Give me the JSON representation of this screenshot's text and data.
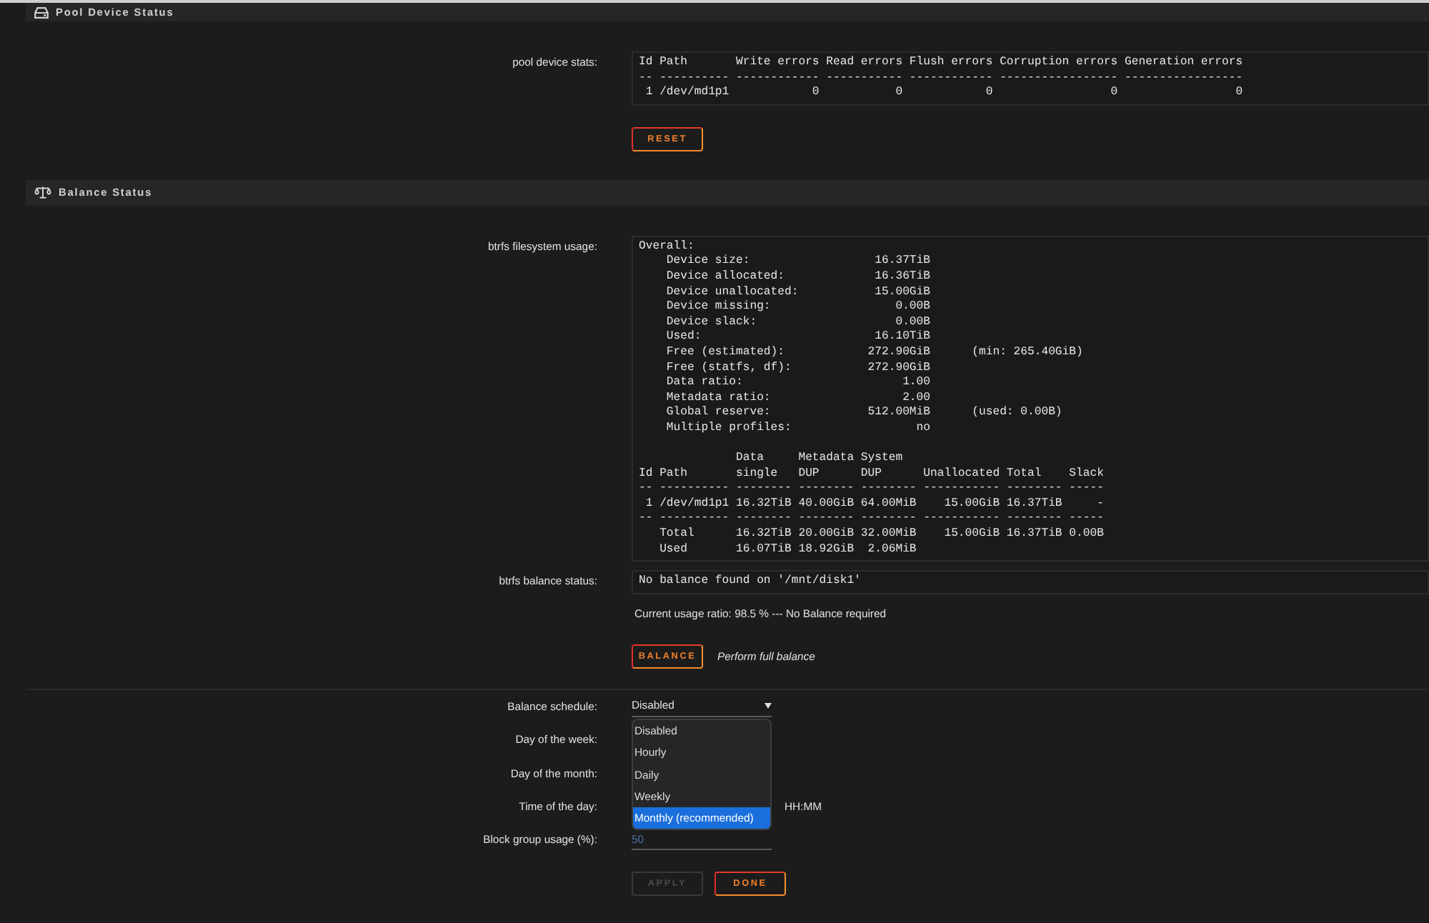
{
  "pool_device_status": {
    "title": "Pool Device Status",
    "stats": {
      "label": "pool device stats:",
      "lines": [
        "Id Path       Write errors Read errors Flush errors Corruption errors Generation errors",
        "-- ---------- ------------ ----------- ------------ ----------------- -----------------",
        " 1 /dev/md1p1            0           0            0                 0                 0"
      ]
    },
    "button": {
      "label": "RESET",
      "disabled": false
    }
  },
  "balance_status": {
    "title": "Balance Status",
    "filesystem_usage": {
      "label": "btrfs filesystem usage:",
      "summary_lines": [
        "Overall:",
        "    Device size:                  16.37TiB",
        "    Device allocated:             16.36TiB",
        "    Device unallocated:           15.00GiB",
        "    Device missing:                  0.00B",
        "    Device slack:                    0.00B",
        "    Used:                         16.10TiB",
        "    Free (estimated):            272.90GiB      (min: 265.40GiB)",
        "    Free (statfs, df):           272.90GiB",
        "    Data ratio:                       1.00",
        "    Metadata ratio:                   2.00",
        "    Global reserve:              512.00MiB      (used: 0.00B)",
        "    Multiple profiles:                  no"
      ],
      "table_lines": [
        "              Data     Metadata System",
        "Id Path       single   DUP      DUP      Unallocated Total    Slack",
        "-- ---------- -------- -------- -------- ----------- -------- -----",
        " 1 /dev/md1p1 16.32TiB 40.00GiB 64.00MiB    15.00GiB 16.37TiB     -",
        "-- ---------- -------- -------- -------- ----------- -------- -----",
        "   Total      16.32TiB 20.00GiB 32.00MiB    15.00GiB 16.37TiB 0.00B",
        "   Used       16.07TiB 18.92GiB  2.06MiB"
      ]
    },
    "balance_output": {
      "label": "btrfs balance status:",
      "lines": [
        "No balance found on '/mnt/disk1'"
      ]
    },
    "usage_ratio": "Current usage ratio: 98.5 % --- No Balance required",
    "button": {
      "label": "BALANCE",
      "disabled": false
    },
    "button_note": "Perform full balance",
    "schedule_form": {
      "fields": [
        {
          "kind": "select",
          "label": "Balance schedule:",
          "value": "Disabled",
          "expanded": true,
          "options": [
            {
              "label": "Disabled",
              "highlighted": false
            },
            {
              "label": "Hourly",
              "highlighted": false
            },
            {
              "label": "Daily",
              "highlighted": false
            },
            {
              "label": "Weekly",
              "highlighted": false
            },
            {
              "label": "Monthly (recommended)",
              "highlighted": true
            }
          ]
        },
        {
          "kind": "obscured",
          "label": "Day of the week:"
        },
        {
          "kind": "obscured",
          "label": "Day of the month:"
        },
        {
          "kind": "obscured",
          "label": "Time of the day:",
          "unit": "HH:MM"
        },
        {
          "kind": "input",
          "label": "Block group usage (%):",
          "value": "50"
        }
      ],
      "buttons": [
        {
          "label": "APPLY",
          "disabled": true
        },
        {
          "label": "DONE",
          "disabled": false
        }
      ]
    }
  }
}
